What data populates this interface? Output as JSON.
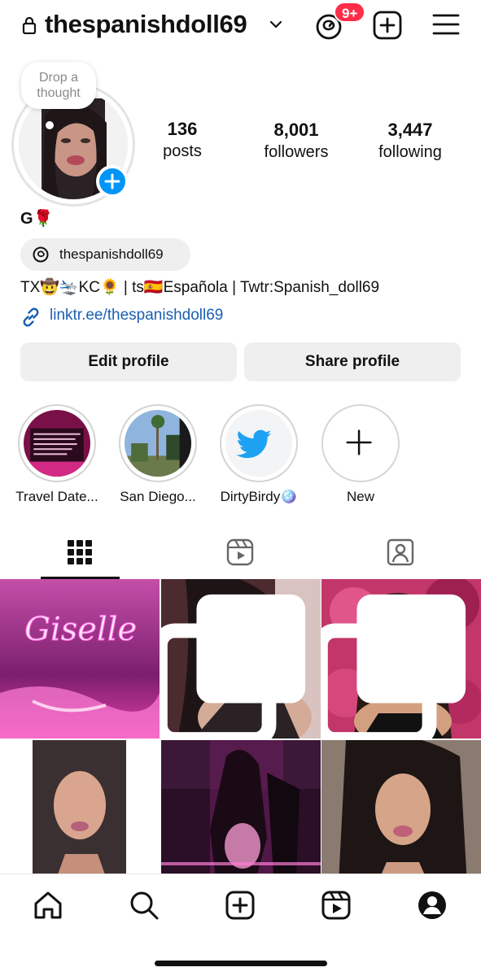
{
  "header": {
    "username": "thespanishdoll69",
    "threads_badge": "9+"
  },
  "profile": {
    "thought_bubble": "Drop a thought",
    "display_name": "G🌹",
    "threads_handle": "thespanishdoll69",
    "bio": "TX🤠🛬KC🌻 | ts🇪🇸Española | Twtr:Spanish_doll69",
    "link": "linktr.ee/thespanishdoll69"
  },
  "stats": [
    {
      "value": "136",
      "label": "posts"
    },
    {
      "value": "8,001",
      "label": "followers"
    },
    {
      "value": "3,447",
      "label": "following"
    }
  ],
  "buttons": {
    "edit": "Edit profile",
    "share": "Share profile"
  },
  "highlights": [
    {
      "label": "Travel Date..."
    },
    {
      "label": "San Diego..."
    },
    {
      "label": "DirtyBirdy🪩"
    },
    {
      "label": "New"
    }
  ],
  "tabs": [
    {
      "icon": "grid-icon",
      "active": true
    },
    {
      "icon": "reels-icon",
      "active": false
    },
    {
      "icon": "tagged-icon",
      "active": false
    }
  ],
  "posts": [
    {
      "caption_in_image": "Giselle",
      "multi": false
    },
    {
      "multi": true
    },
    {
      "multi": true
    },
    {
      "multi": false
    },
    {
      "multi": false
    },
    {
      "multi": false
    }
  ],
  "bottom_nav": [
    "home-icon",
    "search-icon",
    "create-icon",
    "reels-icon",
    "profile-icon"
  ],
  "colors": {
    "accent": "#0095f6",
    "badge": "#ff2d48",
    "link": "#1a5fb4",
    "button_bg": "#efefef",
    "neon_pink": "#ff5fe0"
  }
}
